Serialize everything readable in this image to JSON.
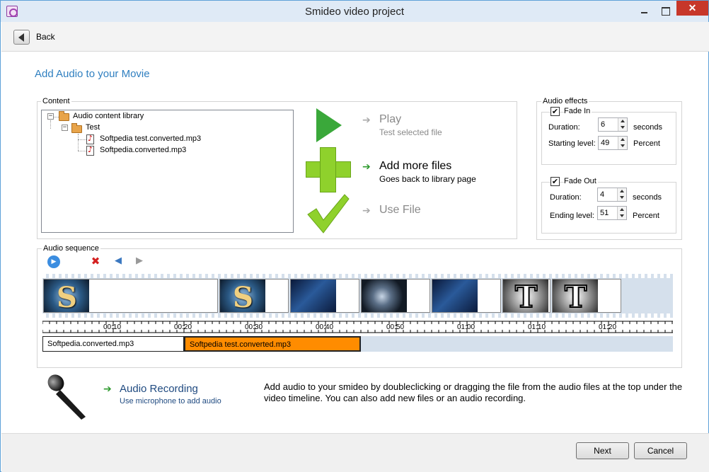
{
  "window": {
    "title": "Smideo video project",
    "close_glyph": "✕"
  },
  "nav": {
    "back_label": "Back"
  },
  "page_title": "Add Audio to your Movie",
  "content": {
    "group_label": "Content",
    "tree": {
      "root": "Audio content library",
      "folder": "Test",
      "files": [
        "Softpedia test.converted.mp3",
        "Softpedia.converted.mp3"
      ],
      "expander_glyph": "−"
    }
  },
  "actions": {
    "play": {
      "title": "Play",
      "subtitle": "Test selected file",
      "arrow": "➔"
    },
    "add": {
      "title": "Add more files",
      "subtitle": "Goes back to library page",
      "arrow": "➔"
    },
    "use": {
      "title": "Use File",
      "arrow": "➔"
    }
  },
  "effects": {
    "group_label": "Audio effects",
    "fade_in": {
      "label": "Fade In",
      "checked_glyph": "✔",
      "duration_label": "Duration:",
      "duration": "6",
      "duration_unit": "seconds",
      "level_label": "Starting level:",
      "level": "49",
      "level_unit": "Percent"
    },
    "fade_out": {
      "label": "Fade Out",
      "checked_glyph": "✔",
      "duration_label": "Duration:",
      "duration": "4",
      "duration_unit": "seconds",
      "level_label": "Ending level:",
      "level": "51",
      "level_unit": "Percent"
    }
  },
  "sequence": {
    "group_label": "Audio sequence",
    "toolbar": {
      "play_icon": "▶",
      "delete_icon": "✖",
      "left_icon": "◀",
      "right_icon": "▶"
    },
    "thumb_letters": {
      "s": "S",
      "t": "T"
    },
    "timeline_labels": [
      "00:10",
      "00:20",
      "00:30",
      "00:40",
      "00:50",
      "01:00",
      "01:10",
      "01:20"
    ],
    "audio_clips": [
      {
        "label": "Softpedia.converted.mp3",
        "color": "#ffffff"
      },
      {
        "label": "Softpedia test.converted.mp3",
        "color": "#ff8c00"
      }
    ]
  },
  "recording": {
    "arrow": "➔",
    "title": "Audio Recording",
    "subtitle": "Use microphone to add audio",
    "help": "Add audio to your smideo by doubleclicking or dragging the file from the audio files at the top under the video timeline. You can also add new files or an audio recording."
  },
  "footer": {
    "next_label": "Next",
    "cancel_label": "Cancel"
  },
  "colors": {
    "accent": "#2f7fc0",
    "selected_clip": "#ff8c00",
    "play_green": "#3aa83a",
    "plus_green": "#8fd12c"
  }
}
